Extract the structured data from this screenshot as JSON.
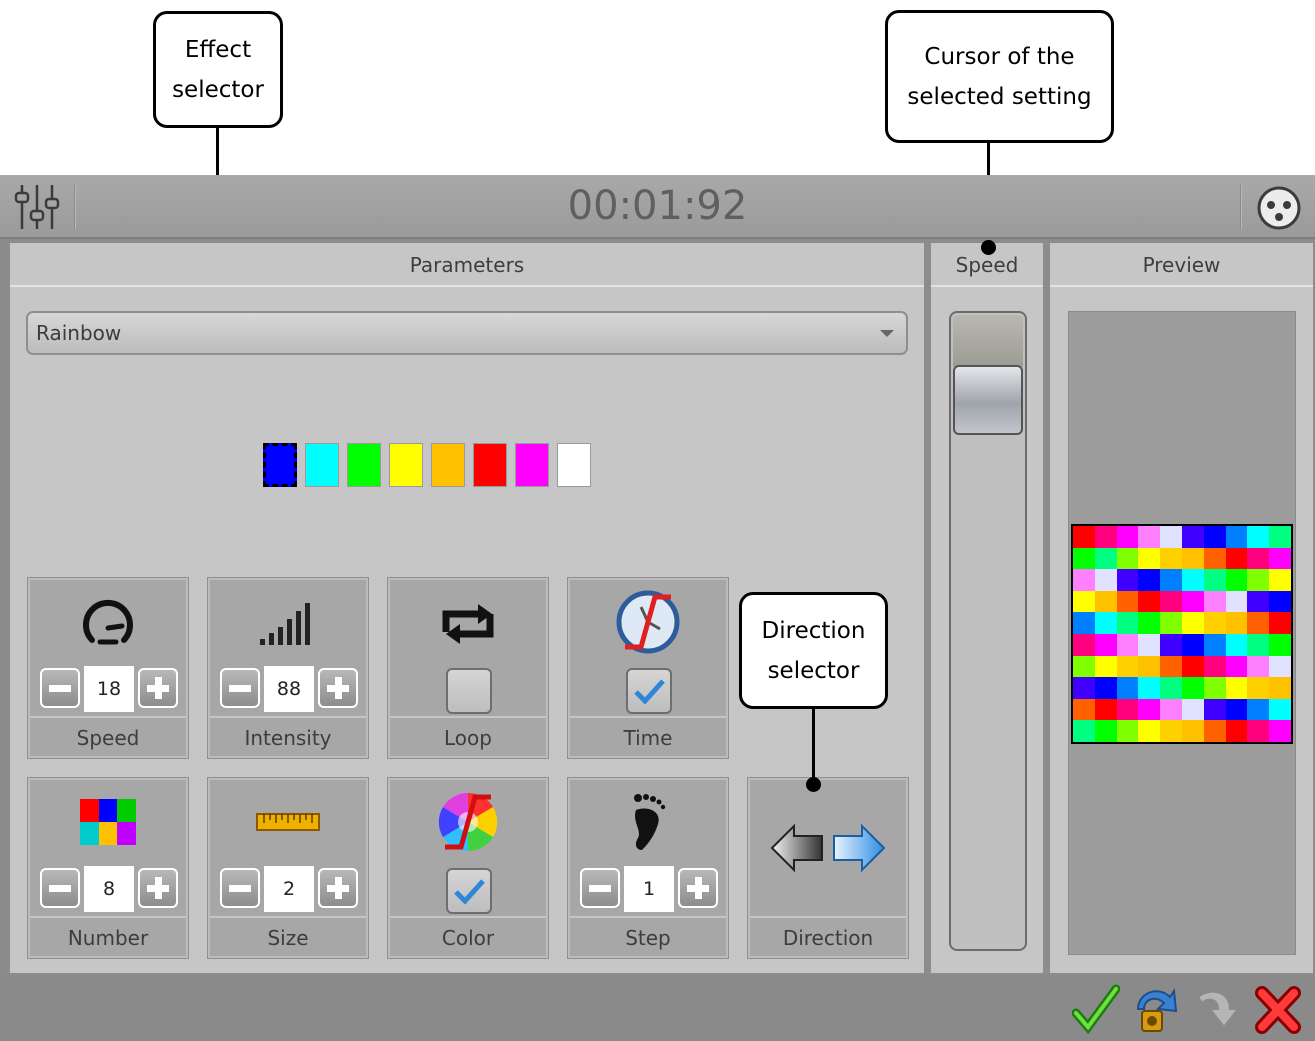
{
  "callouts": {
    "effect_line1": "Effect",
    "effect_line2": "selector",
    "cursor_line1": "Cursor of the",
    "cursor_line2": "selected setting",
    "direction_line1": "Direction",
    "direction_line2": "selector"
  },
  "titlebar": {
    "timer": "00:01:92"
  },
  "panels": {
    "parameters": "Parameters",
    "speed": "Speed",
    "preview": "Preview"
  },
  "effect": {
    "selected": "Rainbow"
  },
  "swatches": [
    "#0000ff",
    "#00ffff",
    "#00ff00",
    "#ffff00",
    "#ffc000",
    "#ff0000",
    "#ff00ff",
    "#ffffff"
  ],
  "tiles": {
    "speed": {
      "label": "Speed",
      "value": "18"
    },
    "intensity": {
      "label": "Intensity",
      "value": "88"
    },
    "loop": {
      "label": "Loop",
      "checked": false
    },
    "time": {
      "label": "Time",
      "checked": true
    },
    "number": {
      "label": "Number",
      "value": "8"
    },
    "size": {
      "label": "Size",
      "value": "2"
    },
    "color": {
      "label": "Color",
      "checked": true
    },
    "step": {
      "label": "Step",
      "value": "1"
    },
    "direction": {
      "label": "Direction"
    }
  },
  "icons": {
    "settings": "sliders-icon",
    "dmx": "dmx-connector-icon",
    "speed": "speedometer-icon",
    "intensity": "signal-bars-icon",
    "loop": "loop-icon",
    "time": "clock-disabled-icon",
    "number": "color-grid-icon",
    "size": "ruler-icon",
    "color": "color-wheel-disabled-icon",
    "step": "footprint-icon",
    "confirm": "check-icon",
    "record": "record-icon",
    "redo": "redo-arrow-icon",
    "cancel": "close-icon"
  },
  "colors": {
    "preview_rows": [
      [
        "#ff0000",
        "#ff007f",
        "#ff00ff",
        "#ff80ff",
        "#e0e0ff",
        "#4000ff",
        "#0000ff",
        "#0080ff",
        "#00ffff",
        "#00ff80"
      ],
      [
        "#00ff00",
        "#00ff80",
        "#80ff00",
        "#ffff00",
        "#ffd000",
        "#ffc000",
        "#ff6000",
        "#ff0000",
        "#ff007f",
        "#ff00ff"
      ],
      [
        "#ff80ff",
        "#e0e0ff",
        "#4000ff",
        "#0000ff",
        "#0080ff",
        "#00ffff",
        "#00ff80",
        "#00ff00",
        "#80ff00",
        "#ffff00"
      ],
      [
        "#ffff00",
        "#ffc000",
        "#ff6000",
        "#ff0000",
        "#ff007f",
        "#ff00ff",
        "#ff80ff",
        "#e0e0ff",
        "#4000ff",
        "#0000ff"
      ],
      [
        "#0080ff",
        "#00ffff",
        "#00ff80",
        "#00ff00",
        "#80ff00",
        "#ffff00",
        "#ffd000",
        "#ffc000",
        "#ff6000",
        "#ff0000"
      ],
      [
        "#ff007f",
        "#ff00ff",
        "#ff80ff",
        "#e0e0ff",
        "#4000ff",
        "#0000ff",
        "#0080ff",
        "#00ffff",
        "#00ff80",
        "#00ff00"
      ],
      [
        "#80ff00",
        "#ffff00",
        "#ffd000",
        "#ffc000",
        "#ff6000",
        "#ff0000",
        "#ff007f",
        "#ff00ff",
        "#ff80ff",
        "#e0e0ff"
      ],
      [
        "#4000ff",
        "#0000ff",
        "#0080ff",
        "#00ffff",
        "#00ff80",
        "#00ff00",
        "#80ff00",
        "#ffff00",
        "#ffd000",
        "#ffc000"
      ],
      [
        "#ff6000",
        "#ff0000",
        "#ff007f",
        "#ff00ff",
        "#ff80ff",
        "#e0e0ff",
        "#4000ff",
        "#0000ff",
        "#0080ff",
        "#00ffff"
      ],
      [
        "#00ff80",
        "#00ff00",
        "#80ff00",
        "#ffff00",
        "#ffd000",
        "#ffc000",
        "#ff6000",
        "#ff0000",
        "#ff007f",
        "#ff00ff"
      ]
    ]
  }
}
